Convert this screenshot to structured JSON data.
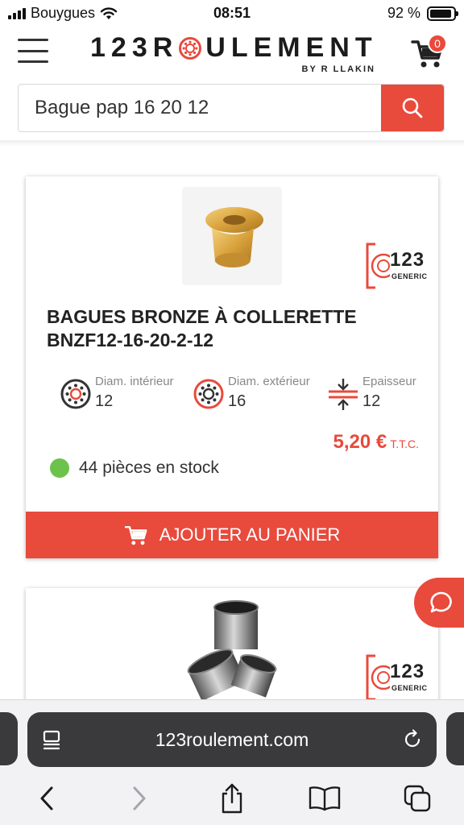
{
  "status_bar": {
    "carrier": "Bouygues",
    "time": "08:51",
    "battery": "92 %",
    "battery_level": 0.92
  },
  "header": {
    "logo_left": "123R",
    "logo_right": "ULEMENT",
    "logo_tagline": "BY R   LLAKIN",
    "cart_count": "0"
  },
  "search": {
    "value": "Bague pap 16 20 12"
  },
  "products": [
    {
      "title": "BAGUES BRONZE À COLLERETTE BNZF12-16-20-2-12",
      "generic_number": "123",
      "generic_label": "GENERIC",
      "specs": [
        {
          "label": "Diam. intérieur",
          "value": "12",
          "icon": "bearing-inner-icon"
        },
        {
          "label": "Diam. extérieur",
          "value": "16",
          "icon": "bearing-outer-icon"
        },
        {
          "label": "Epaisseur",
          "value": "12",
          "icon": "thickness-icon"
        }
      ],
      "price": "5,20 €",
      "price_suffix": "T.T.C.",
      "stock": "44 pièces en stock",
      "add_to_cart": "AJOUTER AU PANIER"
    },
    {
      "generic_number": "123",
      "generic_label": "GENERIC"
    }
  ],
  "browser": {
    "url": "123roulement.com"
  },
  "colors": {
    "accent": "#e84a3c",
    "stock_green": "#6cc24a",
    "text_dark": "#222222"
  }
}
